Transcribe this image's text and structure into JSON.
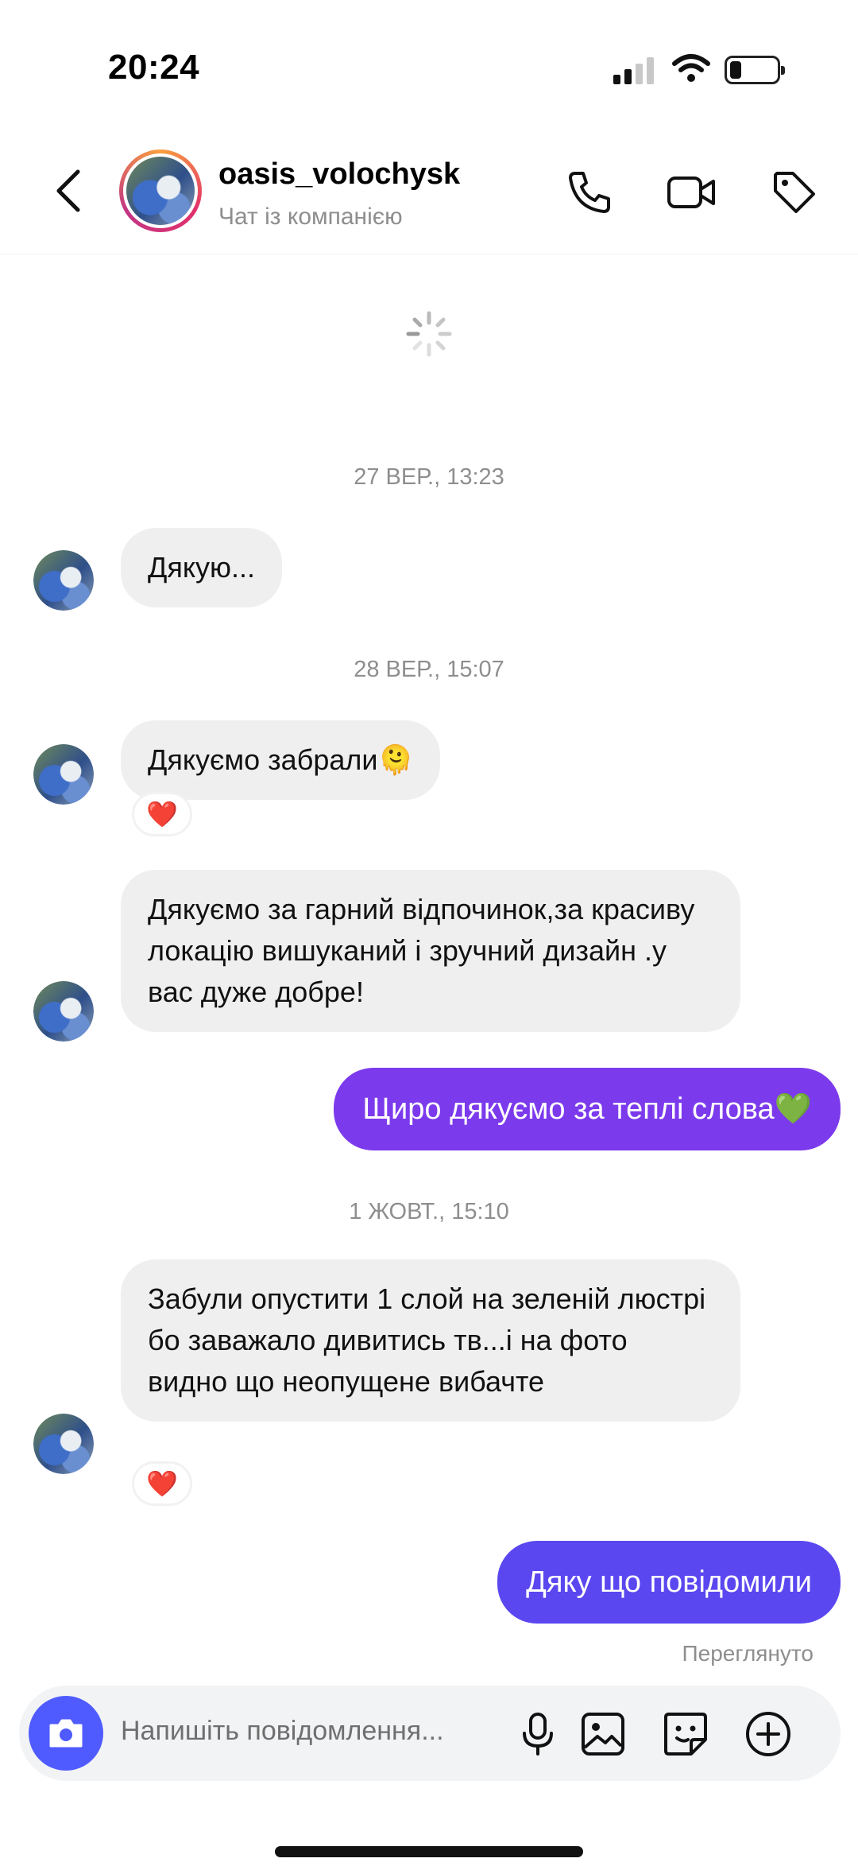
{
  "status_bar": {
    "time": "20:24"
  },
  "header": {
    "name": "oasis_volochysk",
    "subtitle": "Чат із компанією",
    "icons": [
      "back-icon",
      "phone-icon",
      "video-icon",
      "tag-icon"
    ]
  },
  "messages": [
    {
      "type": "timestamp",
      "text": "27 ВЕР., 13:23"
    },
    {
      "type": "incoming",
      "text": "Дякую..."
    },
    {
      "type": "timestamp",
      "text": "28 ВЕР., 15:07"
    },
    {
      "type": "incoming",
      "text": "Дякуємо забрали🫠",
      "reaction": "❤️"
    },
    {
      "type": "incoming",
      "text": "Дякуємо за гарний відпочинок,за красиву локацію вишуканий і зручний дизайн .у вас дуже добре!"
    },
    {
      "type": "outgoing",
      "text": "Щиро дякуємо за теплі слова💚"
    },
    {
      "type": "timestamp",
      "text": "1 ЖОВТ., 15:10"
    },
    {
      "type": "incoming",
      "text": "Забули опустити 1 слой на зеленій люстрі бо заважало дивитись тв...і на фото видно що неопущене вибачте",
      "reaction": "❤️"
    },
    {
      "type": "outgoing",
      "text": "Дяку що повідомили",
      "status": "Переглянуто"
    }
  ],
  "composer": {
    "placeholder": "Напишіть повідомлення...",
    "icons": [
      "camera-icon",
      "microphone-icon",
      "gallery-icon",
      "sticker-icon",
      "plus-icon"
    ]
  },
  "colors": {
    "outgoing_bubble": "#7c3aed",
    "outgoing_bubble_last": "#5a47f0",
    "incoming_bubble": "#efefef",
    "camera_button": "#4f5bff"
  }
}
